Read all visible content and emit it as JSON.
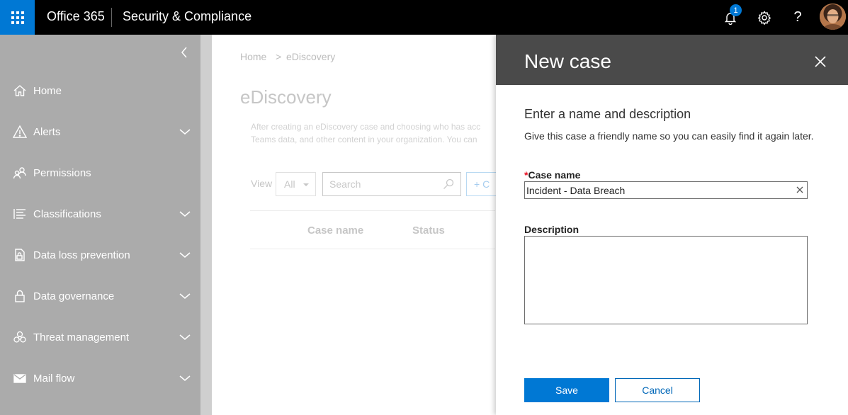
{
  "topbar": {
    "brand": "Office 365",
    "app_name": "Security & Compliance",
    "notification_count": "1",
    "help_glyph": "?",
    "icons": [
      "app-launcher-icon",
      "bell-icon",
      "gear-icon",
      "help-icon",
      "avatar"
    ]
  },
  "sidebar": {
    "items": [
      {
        "label": "Home",
        "icon": "home-icon",
        "expandable": false
      },
      {
        "label": "Alerts",
        "icon": "alert-icon",
        "expandable": true
      },
      {
        "label": "Permissions",
        "icon": "people-icon",
        "expandable": false
      },
      {
        "label": "Classifications",
        "icon": "list-icon",
        "expandable": true
      },
      {
        "label": "Data loss prevention",
        "icon": "dlp-icon",
        "expandable": true
      },
      {
        "label": "Data governance",
        "icon": "lock-icon",
        "expandable": true
      },
      {
        "label": "Threat management",
        "icon": "biohazard-icon",
        "expandable": true
      },
      {
        "label": "Mail flow",
        "icon": "mail-icon",
        "expandable": true
      }
    ]
  },
  "main": {
    "breadcrumb": {
      "home": "Home",
      "separator": ">",
      "current": "eDiscovery"
    },
    "title": "eDiscovery",
    "intro_line1": "After creating an eDiscovery case and choosing who has acc",
    "intro_line2": "Teams data, and other content in your organization. You can",
    "view_label": "View",
    "view_value": "All",
    "search_placeholder": "Search",
    "create_label": "+ C",
    "columns": [
      "Case name",
      "Status"
    ]
  },
  "panel": {
    "title": "New case",
    "section_title": "Enter a name and description",
    "section_desc": "Give this case a friendly name so you can easily find it again later.",
    "case_name_required_mark": "*",
    "case_name_label": "Case name",
    "case_name_value": "Incident - Data Breach",
    "description_label": "Description",
    "description_value": "",
    "save_label": "Save",
    "cancel_label": "Cancel"
  },
  "colors": {
    "accent": "#0078d4",
    "topbar": "#000000",
    "sidebar": "#ababab",
    "panel_header": "#4a4a4a",
    "required": "#e81123"
  }
}
